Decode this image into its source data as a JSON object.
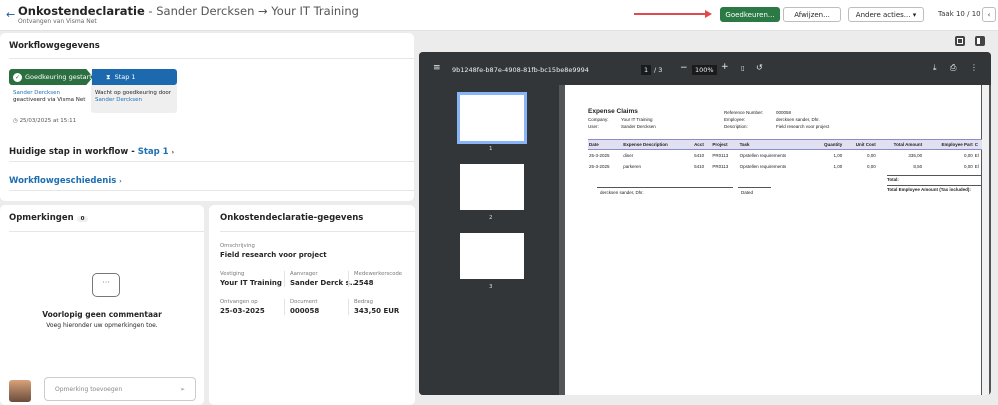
{
  "header": {
    "title": "Onkostendeclaratie",
    "title_rest": " - Sander Dercksen → Your IT Training",
    "subtitle": "Ontvangen van Visma Net",
    "approve": "Goedkeuren...",
    "reject": "Afwijzen...",
    "other": "Andere acties...",
    "task": "Taak 10 / 10"
  },
  "workflow": {
    "title": "Workflowgegevens",
    "step0": "Goedkeuring gestart",
    "step0_user": "Sander Dercksen",
    "step0_note": "geactiveerd via Visma Net",
    "step1": "Stap 1",
    "step1_note": "Wacht op goedkeuring door",
    "step1_user": "Sander Dercksen",
    "timestamp": "25/03/2025 at 15:11",
    "current_label": "Huidige stap in workflow",
    "current_sep": "-",
    "current_value": "Stap 1",
    "history": "Workflowgeschiedenis"
  },
  "comments": {
    "title": "Opmerkingen",
    "count": "0",
    "empty_title": "Voorlopig geen commentaar",
    "empty_sub": "Voeg hieronder uw opmerkingen toe.",
    "placeholder": "Opmerking toevoegen"
  },
  "details": {
    "title": "Onkostendeclaratie-gegevens",
    "desc_label": "Omschrijving",
    "desc": "Field research voor project",
    "fields": [
      {
        "label": "Vestiging",
        "value": "Your IT Training"
      },
      {
        "label": "Aanvrager",
        "value": "Sander Derck s..."
      },
      {
        "label": "Medewerkerscode",
        "value": "2548"
      },
      {
        "label": "Ontvangen op",
        "value": "25-03-2025"
      },
      {
        "label": "Document",
        "value": "000058"
      },
      {
        "label": "Bedrag",
        "value": "343,50 EUR"
      }
    ]
  },
  "pdf": {
    "filename": "9b1248fe-b87e-4908-81fb-bc15be8e9994",
    "page": "1",
    "pages": "/ 3",
    "zoom": "100%",
    "thumbs": [
      "1",
      "2",
      "3"
    ],
    "doc": {
      "title": "Expense Claims",
      "company_label": "Company:",
      "company": "Your IT Training",
      "user_label": "User:",
      "user": "Sander Dercksen",
      "ref_label": "Reference Number:",
      "ref": "000058",
      "emp_label": "Employee:",
      "emp": "dercksen sander, Dhr.",
      "descr_label": "Description:",
      "descr": "Field research voor project",
      "columns": [
        "Date",
        "Expense Description",
        "Acct",
        "Project",
        "Task",
        "Quantity",
        "Unit Cost",
        "Total Amount",
        "Employee Part",
        "C"
      ],
      "rows": [
        [
          "25-3-2025",
          "diner",
          "5410",
          "PR0113",
          "Opstellen requirements",
          "1,00",
          "0,00",
          "335,00",
          "0,00",
          "El"
        ],
        [
          "25-3-2025",
          "parkeren",
          "5410",
          "PR0113",
          "Opstellen requirements",
          "1,00",
          "0,00",
          "8,50",
          "0,00",
          "El"
        ]
      ],
      "total": "Total:",
      "total_emp": "Total Employee Amount (Tax included):",
      "sign": "dercksen sander, Dhr.",
      "dated": "Dated"
    }
  }
}
